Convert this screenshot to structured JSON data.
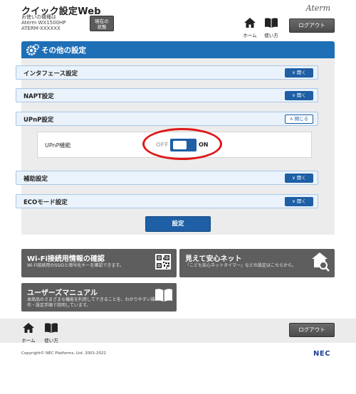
{
  "header": {
    "app_title": "クイック設定Web",
    "device_label": "お使いの機種は",
    "model": "Aterm WX1500HP",
    "ssid_name": "ATERM-XXXXXX",
    "status_button": [
      "現在の",
      "状態"
    ],
    "brand": "Aterm",
    "home_label": "ホーム",
    "help_label": "使い方",
    "logout_label": "ログアウト"
  },
  "section": {
    "title": "その他の設定",
    "items": [
      {
        "label": "インタフェース設定",
        "button": "開く"
      },
      {
        "label": "NAPT設定",
        "button": "開く"
      },
      {
        "label": "UPnP設定",
        "button": "閉じる"
      },
      {
        "label": "補助設定",
        "button": "開く"
      },
      {
        "label": "ECOモード設定",
        "button": "開く"
      }
    ],
    "upnp": {
      "label": "UPnP機能",
      "off": "OFF",
      "on": "ON",
      "state": "ON"
    },
    "set_button": "設定"
  },
  "cards": {
    "wifi": {
      "title": "Wi-Fi接続用情報の確認",
      "desc": "Wi-Fi接続用のSSIDと暗号化キーを確認できます。"
    },
    "safe": {
      "title": "見えて安心ネット",
      "desc": "「こども安心ネットタイマー」などの設定はこちらから。"
    },
    "manual": {
      "title": "ユーザーズマニュアル",
      "desc_line1": "本商品のさまざまな機能を利用してできることを、わかりやすい操",
      "desc_line2": "作・設定手順で説明しています。"
    }
  },
  "footer": {
    "home_label": "ホーム",
    "help_label": "使い方",
    "logout_label": "ログアウト",
    "copyright": "Copyright© NEC Platforms, Ltd. 2001-2022",
    "logo": "NEC"
  },
  "colors": {
    "accent_blue": "#1e6fb6",
    "button_blue": "#1e5fa5",
    "highlight_red": "#e01818",
    "card_gray": "#5e5e5e"
  }
}
